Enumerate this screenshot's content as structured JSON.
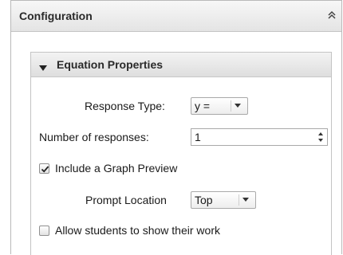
{
  "panel": {
    "title": "Configuration",
    "collapse_icon": "double-chevron-up-icon"
  },
  "section": {
    "title": "Equation Properties",
    "toggle_icon": "triangle-down-icon"
  },
  "fields": {
    "response_type": {
      "label": "Response Type:",
      "value": "y ="
    },
    "number_of_responses": {
      "label": "Number of responses:",
      "value": "1"
    },
    "include_graph": {
      "label": "Include a Graph Preview",
      "checked": true
    },
    "prompt_location": {
      "label": "Prompt Location",
      "value": "Top"
    },
    "allow_show_work": {
      "label": "Allow students to show their work",
      "checked": false
    }
  }
}
